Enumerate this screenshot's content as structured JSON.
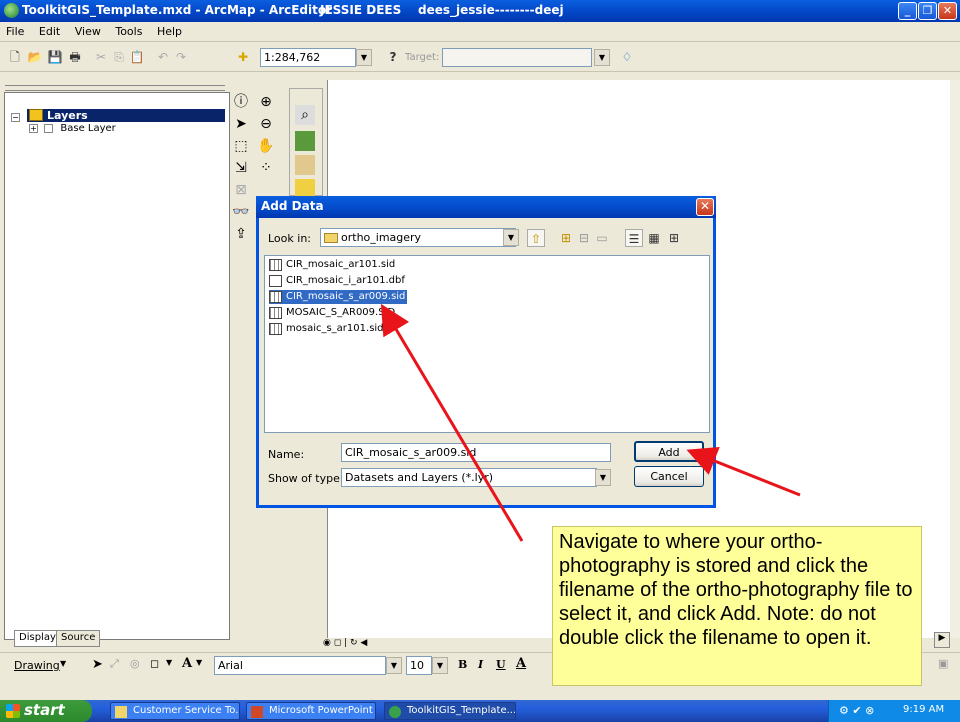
{
  "title_bar": {
    "title": "ToolkitGIS_Template.mxd - ArcMap - ArcEditor",
    "user": "JESSIE DEES",
    "account": "dees_jessie--------deej"
  },
  "menu": [
    "File",
    "Edit",
    "View",
    "Tools",
    "Help"
  ],
  "toolbar": {
    "scale": "1:284,762",
    "target_label": "Target:"
  },
  "toc": {
    "root": "Layers",
    "layer": "Base Layer"
  },
  "tabs": {
    "display": "Display",
    "source": "Source"
  },
  "drawing": {
    "label": "Drawing",
    "text_tool": "A",
    "font": "Arial",
    "font_size": "10",
    "bold": "B",
    "italic": "I",
    "underline": "U"
  },
  "dialog": {
    "title": "Add Data",
    "look_in_label": "Look in:",
    "look_in_value": "ortho_imagery",
    "files": [
      "CIR_mosaic_ar101.sid",
      "CIR_mosaic_i_ar101.dbf",
      "CIR_mosaic_s_ar009.sid",
      "MOSAIC_S_AR009.SID",
      "mosaic_s_ar101.sid"
    ],
    "selected_index": 2,
    "name_label": "Name:",
    "name_value": "CIR_mosaic_s_ar009.sid",
    "type_label": "Show of type:",
    "type_value": "Datasets and Layers (*.lyr)",
    "add_button": "Add",
    "cancel_button": "Cancel"
  },
  "annotation": "Navigate to where your ortho-photography is stored and click the filename of the ortho-photography file to select it, and click Add. Note: do not double click the filename to open it.",
  "taskbar": {
    "start": "start",
    "items": [
      "Customer Service To...",
      "Microsoft PowerPoint ...",
      "ToolkitGIS_Template...."
    ],
    "clock": "9:19 AM"
  },
  "colors": {
    "selection": "#316ac5",
    "annotation_bg": "#ffff99",
    "arrow": "#e8141a"
  }
}
